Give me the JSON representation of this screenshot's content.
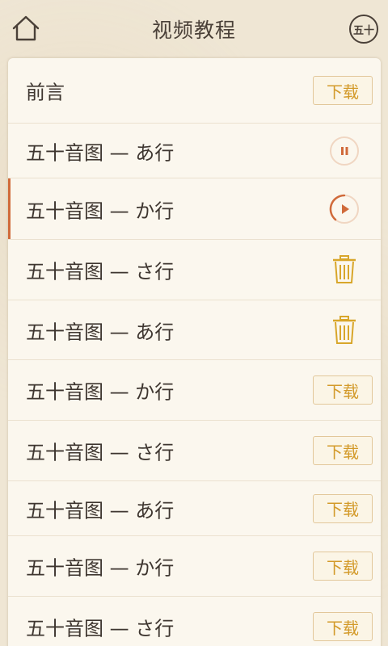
{
  "header": {
    "title": "视频教程",
    "home_icon": "home-icon",
    "logo_label": "五十"
  },
  "colors": {
    "accent": "#d06a3a",
    "download": "#d39a2a",
    "trash": "#d8a62a",
    "text": "#3e3630"
  },
  "list": {
    "items": [
      {
        "label": "前言",
        "action": "download",
        "action_label": "下载"
      },
      {
        "label": "五十音图 — あ行",
        "action": "pause"
      },
      {
        "label": "五十音图 — か行",
        "action": "play"
      },
      {
        "label": "五十音图 — さ行",
        "action": "delete"
      },
      {
        "label": "五十音图 — あ行",
        "action": "delete"
      },
      {
        "label": "五十音图 — か行",
        "action": "download",
        "action_label": "下载"
      },
      {
        "label": "五十音图 — さ行",
        "action": "download",
        "action_label": "下载"
      },
      {
        "label": "五十音图 — あ行",
        "action": "download",
        "action_label": "下载"
      },
      {
        "label": "五十音图 — か行",
        "action": "download",
        "action_label": "下载"
      },
      {
        "label": "五十音图 — さ行",
        "action": "download",
        "action_label": "下载"
      }
    ]
  }
}
